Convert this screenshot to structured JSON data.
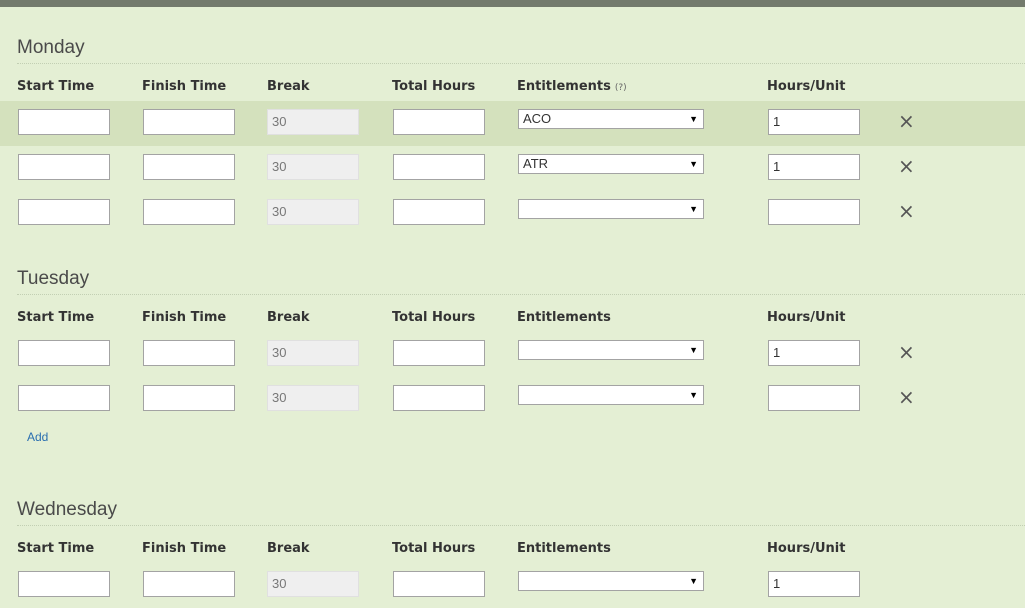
{
  "header_fragment": "............",
  "columns": {
    "start": "Start Time",
    "finish": "Finish Time",
    "break": "Break",
    "total": "Total Hours",
    "entitlements": "Entitlements",
    "entitlements_help": "(?)",
    "hours_unit": "Hours/Unit"
  },
  "delete_glyph": "×",
  "select_arrow": "▼",
  "add_label": "Add",
  "days": [
    {
      "name": "Monday",
      "rows": [
        {
          "start": "",
          "finish": "",
          "break": "30",
          "total": "",
          "entitlement": "ACO",
          "hours_unit": "1"
        },
        {
          "start": "",
          "finish": "",
          "break": "30",
          "total": "",
          "entitlement": "ATR",
          "hours_unit": "1"
        },
        {
          "start": "",
          "finish": "",
          "break": "30",
          "total": "",
          "entitlement": "",
          "hours_unit": ""
        }
      ]
    },
    {
      "name": "Tuesday",
      "rows": [
        {
          "start": "",
          "finish": "",
          "break": "30",
          "total": "",
          "entitlement": "",
          "hours_unit": "1"
        },
        {
          "start": "",
          "finish": "",
          "break": "30",
          "total": "",
          "entitlement": "",
          "hours_unit": ""
        }
      ]
    },
    {
      "name": "Wednesday",
      "rows": [
        {
          "start": "",
          "finish": "",
          "break": "30",
          "total": "",
          "entitlement": "",
          "hours_unit": "1"
        }
      ]
    }
  ]
}
